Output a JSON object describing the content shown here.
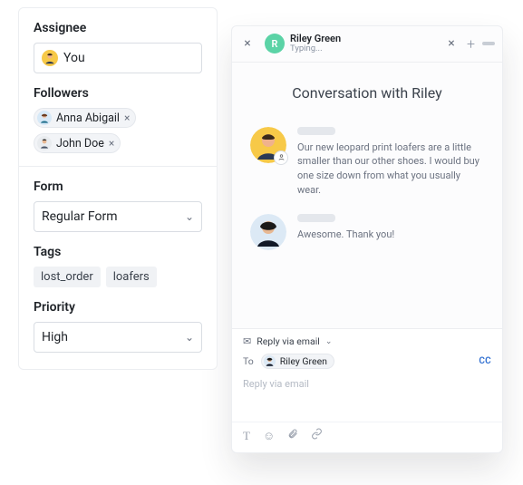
{
  "left": {
    "assignee": {
      "label": "Assignee",
      "value": "You"
    },
    "followers": {
      "label": "Followers",
      "items": [
        {
          "name": "Anna Abigail"
        },
        {
          "name": "John Doe"
        }
      ]
    },
    "form": {
      "label": "Form",
      "value": "Regular Form"
    },
    "tags": {
      "label": "Tags",
      "items": [
        "lost_order",
        "loafers"
      ]
    },
    "priority": {
      "label": "Priority",
      "value": "High"
    }
  },
  "chat": {
    "tab": {
      "avatar_initial": "R",
      "name": "Riley Green",
      "status": "Typing..."
    },
    "title": "Conversation with Riley",
    "messages": [
      {
        "text": "Our new leopard print loafers are a little smaller than our other shoes. I would buy one size down from what you usually wear."
      },
      {
        "text": "Awesome. Thank you!"
      }
    ],
    "reply": {
      "via_label": "Reply via email",
      "to_label": "To",
      "to_name": "Riley Green",
      "cc_label": "CC",
      "placeholder": "Reply via email"
    }
  }
}
